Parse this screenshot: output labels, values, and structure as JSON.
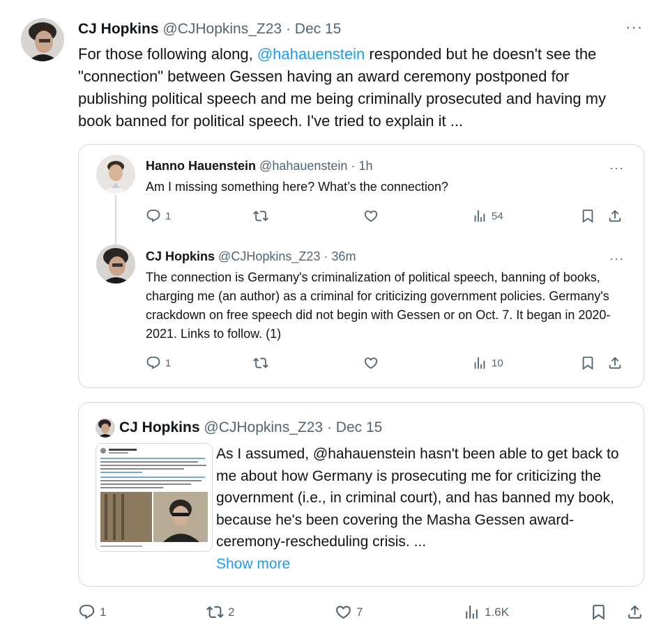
{
  "main_tweet": {
    "author_name": "CJ Hopkins",
    "handle": "@CJHopkins_Z23",
    "separator": "·",
    "date": "Dec 15",
    "more_label": "···",
    "text_before": "For those following along, ",
    "mention": "@hahauenstein",
    "text_after": " responded but he doesn't see the \"connection\" between Gessen having an award ceremony postponed for publishing political speech and me being criminally prosecuted and having my book banned for political speech. I've tried to explain it ...",
    "actions": {
      "replies": "1",
      "retweets": "2",
      "likes": "7",
      "views": "1.6K"
    }
  },
  "thread": [
    {
      "author_name": "Hanno Hauenstein",
      "handle": "@hahauenstein",
      "separator": "·",
      "time": "1h",
      "more_label": "···",
      "text": "Am I missing something here? What’s the connection?",
      "actions": {
        "replies": "1",
        "retweets": "",
        "likes": "",
        "views": "54"
      }
    },
    {
      "author_name": "CJ Hopkins",
      "handle": "@CJHopkins_Z23",
      "separator": "·",
      "time": "36m",
      "more_label": "···",
      "text": "The connection is Germany's criminalization of political speech, banning of books, charging me (an author) as a criminal for criticizing government policies. Germany's crackdown on free speech did not begin with Gessen or on Oct. 7. It began in 2020-2021. Links to follow. (1)",
      "actions": {
        "replies": "1",
        "retweets": "",
        "likes": "",
        "views": "10"
      }
    }
  ],
  "quoted_tweet": {
    "author_name": "CJ Hopkins",
    "handle": "@CJHopkins_Z23",
    "separator": "·",
    "date": "Dec 15",
    "text": "As I assumed, @hahauenstein hasn't been able to get back to me about how Germany is prosecuting me for criticizing the government (i.e., in criminal court), and has banned my book, because he's been covering the Masha Gessen award-ceremony-rescheduling crisis. ...",
    "show_more": "Show more"
  },
  "icons": [
    "reply-icon",
    "retweet-icon",
    "like-icon",
    "views-icon",
    "bookmark-icon",
    "share-icon",
    "more-icon"
  ],
  "colors": {
    "text": "#0f1419",
    "muted": "#536471",
    "link": "#1d9bf0",
    "border": "#cfd9de"
  }
}
